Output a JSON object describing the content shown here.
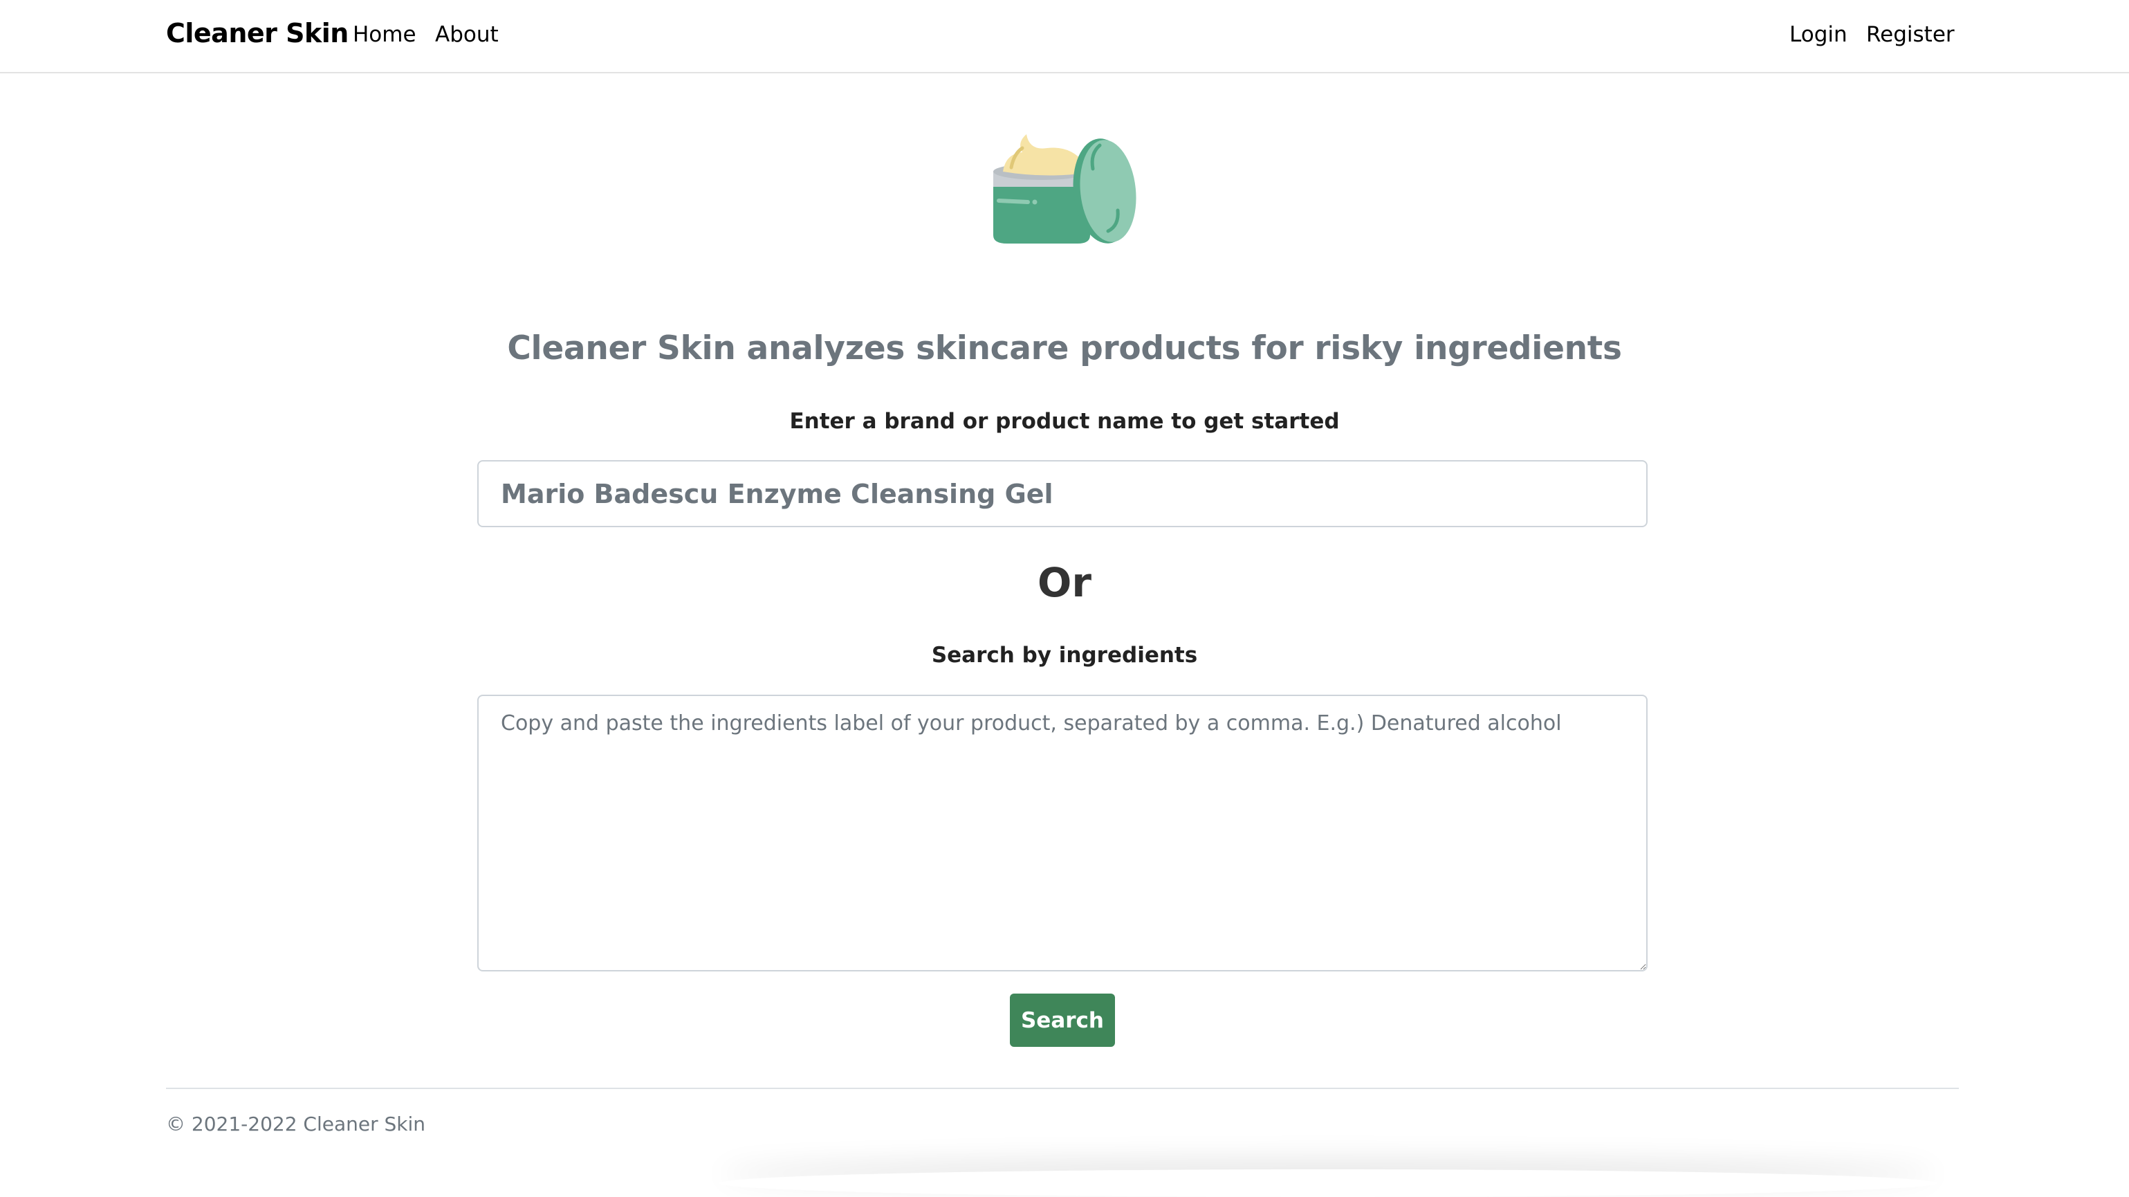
{
  "navbar": {
    "brand": "Cleaner Skin",
    "links": [
      {
        "label": "Home"
      },
      {
        "label": "About"
      }
    ],
    "auth": {
      "login_label": "Login",
      "register_label": "Register"
    }
  },
  "logo": {
    "icon": "cream-jar-icon",
    "colors": {
      "jar": "#4ea683",
      "lid": "#8fcab2",
      "cream": "#f6e3a6",
      "rim": "#c9ced3"
    }
  },
  "main": {
    "headline": "Cleaner Skin analyzes skincare products for risky ingredients",
    "subtitle": "Enter a brand or product name to get started",
    "product_search": {
      "value": "",
      "placeholder": "Mario Badescu Enzyme Cleansing Gel"
    },
    "or_text": "Or",
    "ingredients_label": "Search by ingredients",
    "ingredients_search": {
      "value": "",
      "placeholder": "Copy and paste the ingredients label of your product, separated by a comma. E.g.) Denatured alcohol"
    },
    "search_button_label": "Search"
  },
  "footer": {
    "copyright": "© 2021-2022 Cleaner Skin"
  },
  "colors": {
    "accent": "#3f8659",
    "muted_text": "#6c757d",
    "border": "#ced4da"
  }
}
